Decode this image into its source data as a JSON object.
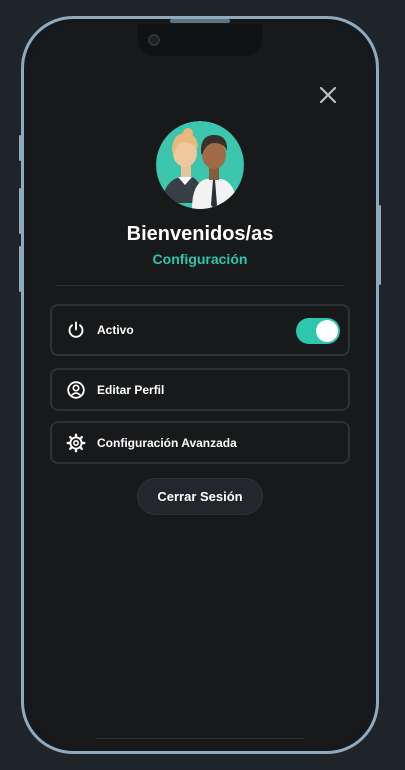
{
  "profile": {
    "title": "Bienvenidos/as",
    "subtitle": "Configuración",
    "avatar_icon": "people-avatar-icon"
  },
  "menu": {
    "active": {
      "label": "Activo",
      "icon": "power-icon",
      "toggle_on": true
    },
    "edit_profile": {
      "label": "Editar Perfil",
      "icon": "user-circle-icon"
    },
    "advanced": {
      "label": "Configuración Avanzada",
      "icon": "gear-icon"
    }
  },
  "actions": {
    "logout_label": "Cerrar Sesión",
    "close_icon": "close-icon"
  },
  "colors": {
    "accent": "#2fc6ae",
    "background": "#17191b",
    "frame": "#8fa9bd",
    "card_border": "#2d3237"
  }
}
